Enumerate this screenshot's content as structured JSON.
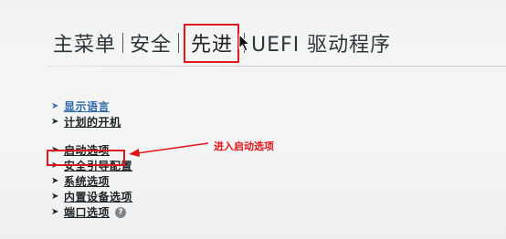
{
  "tabs": [
    "主菜单",
    "安全",
    "先进",
    "UEFI 驱动程序"
  ],
  "active_tab_index": 2,
  "menu": [
    {
      "label": "显示语言",
      "style": "link-blue"
    },
    {
      "label": "计划的开机",
      "style": "normal"
    },
    {
      "label": "启动选项",
      "style": "normal",
      "highlighted": true
    },
    {
      "label": "安全引导配置",
      "style": "normal"
    },
    {
      "label": "系统选项",
      "style": "normal"
    },
    {
      "label": "内置设备选项",
      "style": "normal"
    },
    {
      "label": "端口选项",
      "style": "normal",
      "help_icon": "?"
    }
  ],
  "annotation": {
    "text": "进入启动选项"
  },
  "colors": {
    "annotation_red": "#e2151c",
    "link_blue": "#2f68a8",
    "text_dark": "#1f2326"
  },
  "icons": {
    "menu_arrow": "right-arrow-icon",
    "cursor": "mouse-pointer-icon",
    "help": "help-icon"
  }
}
